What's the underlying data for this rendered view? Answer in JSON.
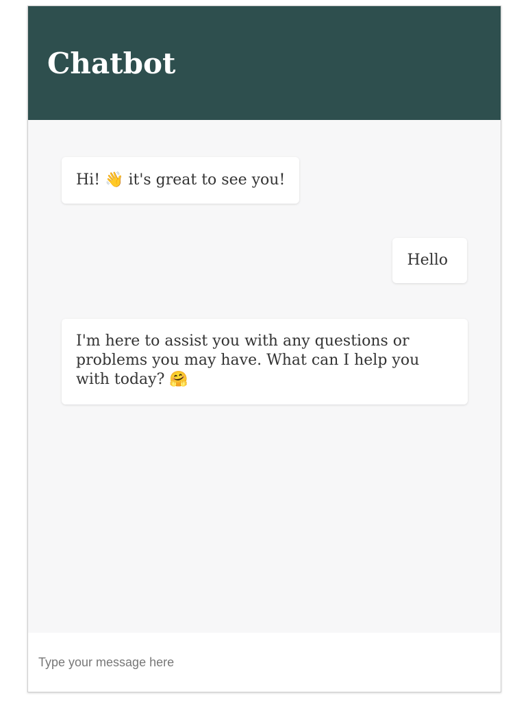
{
  "header": {
    "title": "Chatbot",
    "background_color": "#2e4f4e"
  },
  "messages": [
    {
      "sender": "bot",
      "text": "Hi! 👋 it's great to see you!"
    },
    {
      "sender": "user",
      "text": "Hello"
    },
    {
      "sender": "bot",
      "text": "I'm here to assist you with any questions or problems you may have. What can I help you with today? 🤗"
    }
  ],
  "input": {
    "value": "",
    "placeholder": "Type your message here"
  }
}
